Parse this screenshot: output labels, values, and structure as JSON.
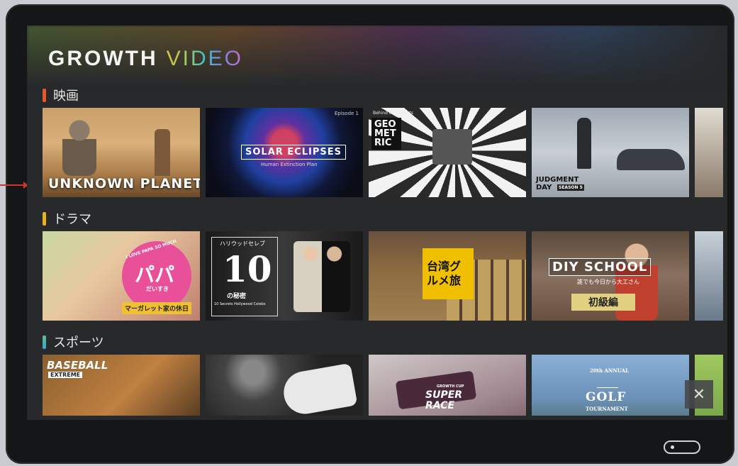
{
  "app": {
    "logo_primary": "GROWTH",
    "logo_secondary": "VIDEO"
  },
  "sections": [
    {
      "title": "映画",
      "accent": "#e8562a",
      "tiles": [
        {
          "caption": "UNKNOWN PLANET"
        },
        {
          "caption": "SOLAR ECLIPSES",
          "sub": "Human Extinction Plan",
          "badge": "Episode 1"
        },
        {
          "caption": "GEO MET RIC",
          "sub": "Behind the Secrets"
        },
        {
          "caption": "JUDGMENT DAY",
          "sub": "SEASON 5"
        },
        {
          "caption": ""
        }
      ]
    },
    {
      "title": "ドラマ",
      "accent": "#e8b020",
      "tiles": [
        {
          "caption": "パパ",
          "sub": "I LOVE PAPA SO MUCH",
          "sub2": "だいすき",
          "label": "マーガレット家の休日"
        },
        {
          "caption": "10",
          "sub": "ハリウッドセレブ",
          "sub2": "の秘密",
          "label": "10 Secrets Hollywood Celebs"
        },
        {
          "caption": "台湾グルメ旅"
        },
        {
          "caption": "DIY SCHOOL",
          "sub": "誰でも今日から大工さん",
          "label": "初級編"
        },
        {
          "caption": ""
        }
      ]
    },
    {
      "title": "スポーツ",
      "accent": "#5cc08a",
      "tiles": [
        {
          "caption": "BASEBALL",
          "sub": "EXTREME"
        },
        {
          "caption": ""
        },
        {
          "caption": "SUPER RACE",
          "sub": "GROWTH CUP"
        },
        {
          "caption": "GOLF",
          "sub": "20th ANNUAL",
          "label": "TOURNAMENT"
        },
        {
          "caption": ""
        }
      ]
    }
  ],
  "controls": {
    "close_glyph": "✕"
  }
}
